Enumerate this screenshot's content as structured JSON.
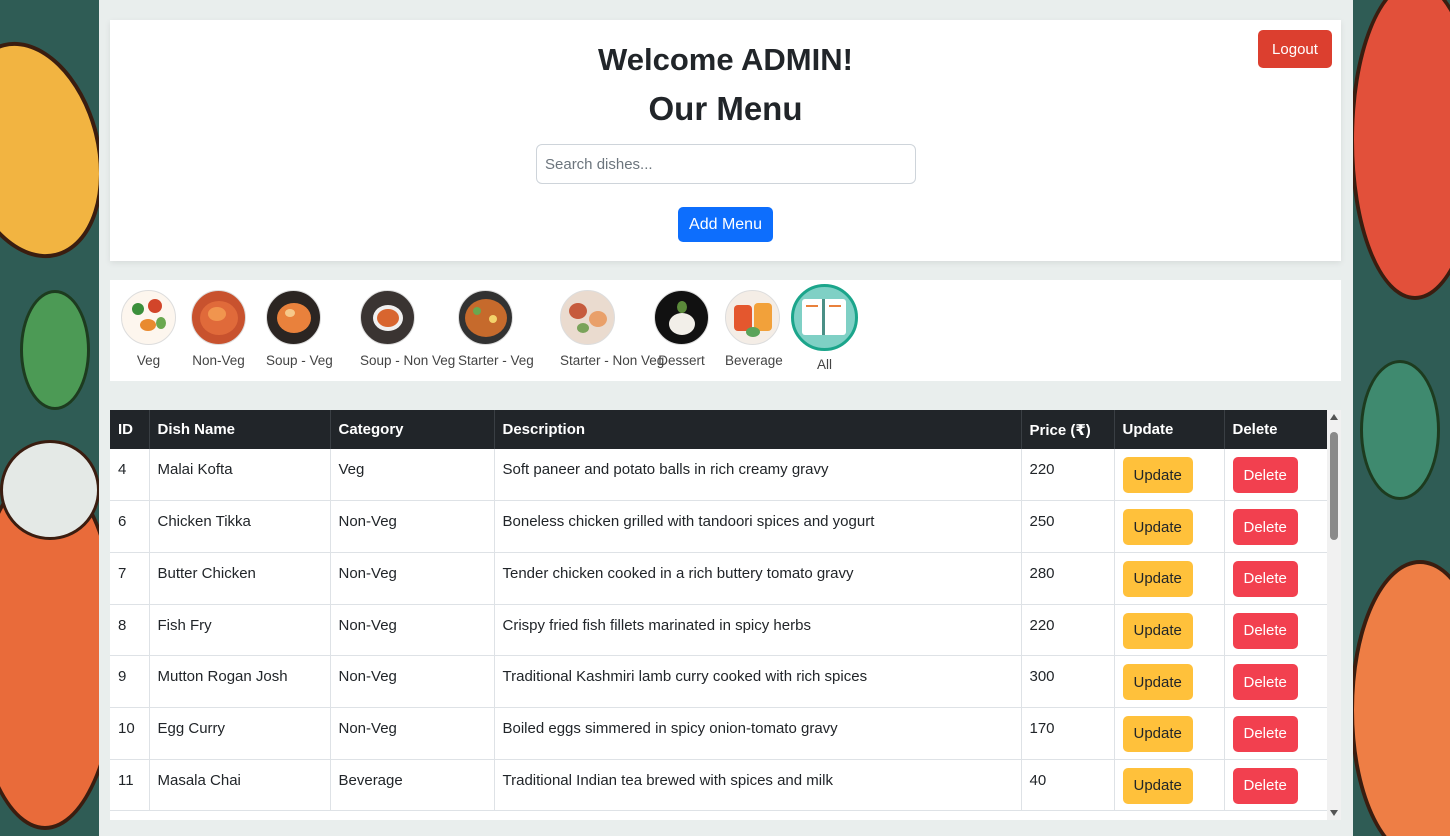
{
  "header": {
    "welcome": "Welcome ADMIN!",
    "title": "Our Menu",
    "search_placeholder": "Search dishes...",
    "add_label": "Add Menu",
    "logout_label": "Logout"
  },
  "categories": [
    {
      "label": "Veg",
      "icon": "veg-icon"
    },
    {
      "label": "Non-Veg",
      "icon": "non-veg-icon"
    },
    {
      "label": "Soup - Veg",
      "icon": "soup-veg-icon"
    },
    {
      "label": "Soup - Non Veg",
      "icon": "soup-non-veg-icon"
    },
    {
      "label": "Starter - Veg",
      "icon": "starter-veg-icon"
    },
    {
      "label": "Starter - Non Veg",
      "icon": "starter-non-veg-icon"
    },
    {
      "label": "Dessert",
      "icon": "dessert-icon"
    },
    {
      "label": "Beverage",
      "icon": "beverage-icon"
    },
    {
      "label": "All",
      "icon": "all-menu-icon",
      "selected": true
    }
  ],
  "table": {
    "columns": [
      "ID",
      "Dish Name",
      "Category",
      "Description",
      "Price (₹)",
      "Update",
      "Delete"
    ],
    "update_label": "Update",
    "delete_label": "Delete",
    "rows": [
      {
        "id": "4",
        "name": "Malai Kofta",
        "category": "Veg",
        "description": "Soft paneer and potato balls in rich creamy gravy",
        "price": "220"
      },
      {
        "id": "6",
        "name": "Chicken Tikka",
        "category": "Non-Veg",
        "description": "Boneless chicken grilled with tandoori spices and yogurt",
        "price": "250"
      },
      {
        "id": "7",
        "name": "Butter Chicken",
        "category": "Non-Veg",
        "description": "Tender chicken cooked in a rich buttery tomato gravy",
        "price": "280"
      },
      {
        "id": "8",
        "name": "Fish Fry",
        "category": "Non-Veg",
        "description": "Crispy fried fish fillets marinated in spicy herbs",
        "price": "220"
      },
      {
        "id": "9",
        "name": "Mutton Rogan Josh",
        "category": "Non-Veg",
        "description": "Traditional Kashmiri lamb curry cooked with rich spices",
        "price": "300"
      },
      {
        "id": "10",
        "name": "Egg Curry",
        "category": "Non-Veg",
        "description": "Boiled eggs simmered in spicy onion-tomato gravy",
        "price": "170"
      },
      {
        "id": "11",
        "name": "Masala Chai",
        "category": "Beverage",
        "description": "Traditional Indian tea brewed with spices and milk",
        "price": "40"
      }
    ]
  },
  "colors": {
    "primary": "#0d6efd",
    "logout": "#dc3f2f",
    "update": "#ffc13b",
    "delete": "#f2404f",
    "table_header": "#212529",
    "active_ring": "#1ba58b"
  }
}
